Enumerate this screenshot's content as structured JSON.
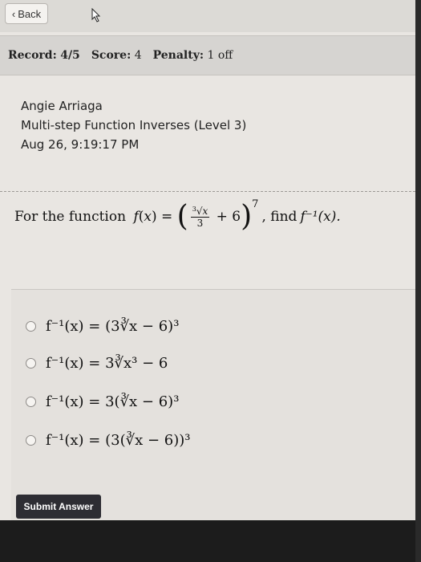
{
  "topbar": {
    "back_label": "Back"
  },
  "record": {
    "record_label": "Record:",
    "record_value": "4/5",
    "score_label": "Score:",
    "score_value": "4",
    "penalty_label": "Penalty:",
    "penalty_value": "1 off"
  },
  "info": {
    "name": "Angie Arriaga",
    "assignment": "Multi-step Function Inverses (Level 3)",
    "datetime": "Aug 26, 9:19:17 PM"
  },
  "question": {
    "prefix": "For the function",
    "suffix": ", find",
    "target": "f⁻¹(x)."
  },
  "options": [
    {
      "text": "f⁻¹(x) = (3∛x − 6)³"
    },
    {
      "text": "f⁻¹(x) = 3∛x³ − 6"
    },
    {
      "text": "f⁻¹(x) = 3(∛x − 6)³"
    },
    {
      "text": "f⁻¹(x) = (3(∛x − 6))³"
    }
  ],
  "submit_label": "Submit Answer",
  "colors": {
    "screen_bg": "#e9e6e2",
    "submit_bg": "#2d2d33"
  }
}
